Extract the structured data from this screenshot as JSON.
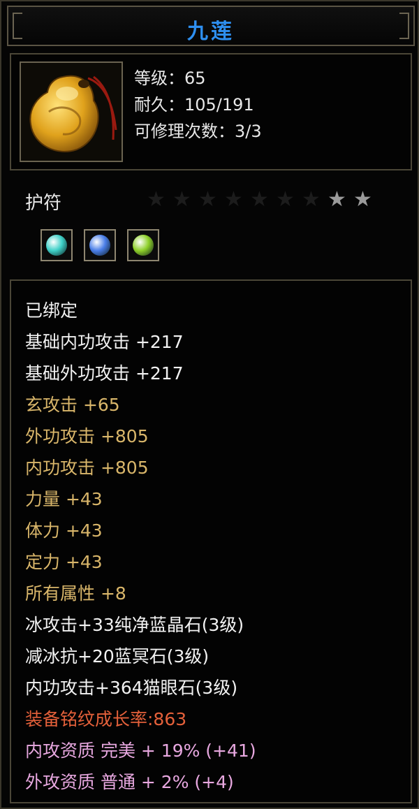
{
  "item": {
    "name": "九莲",
    "level": "等级：65",
    "durability": "耐久：105/191",
    "repairs": "可修理次数：3/3",
    "type": "护符",
    "icon": "amulet-icon"
  },
  "stars": {
    "total": 9,
    "lit": 2
  },
  "gems": [
    {
      "icon": "cyan-gem-icon",
      "color": "#3fd0c8"
    },
    {
      "icon": "blue-gem-icon",
      "color": "#4a7ee8"
    },
    {
      "icon": "green-gem-icon",
      "color": "#8ed02a"
    }
  ],
  "attributes": [
    {
      "text": "已绑定",
      "color": "white"
    },
    {
      "text": "基础内功攻击 +217",
      "color": "white"
    },
    {
      "text": "基础外功攻击 +217",
      "color": "white"
    },
    {
      "text": "玄攻击 +65",
      "color": "gold"
    },
    {
      "text": "外功攻击 +805",
      "color": "gold"
    },
    {
      "text": "内功攻击 +805",
      "color": "gold"
    },
    {
      "text": "力量 +43",
      "color": "gold"
    },
    {
      "text": "体力 +43",
      "color": "gold"
    },
    {
      "text": "定力 +43",
      "color": "gold"
    },
    {
      "text": "所有属性 +8",
      "color": "gold"
    },
    {
      "text": "冰攻击+33纯净蓝晶石(3级)",
      "color": "white"
    },
    {
      "text": "减冰抗+20蓝冥石(3级)",
      "color": "white"
    },
    {
      "text": "内功攻击+364猫眼石(3级)",
      "color": "white"
    },
    {
      "text": "装备铭纹成长率:863",
      "color": "red"
    },
    {
      "text": "内攻资质 完美 + 19% (+41)",
      "color": "pink"
    },
    {
      "text": "外攻资质 普通 + 2% (+4)",
      "color": "pink"
    }
  ]
}
